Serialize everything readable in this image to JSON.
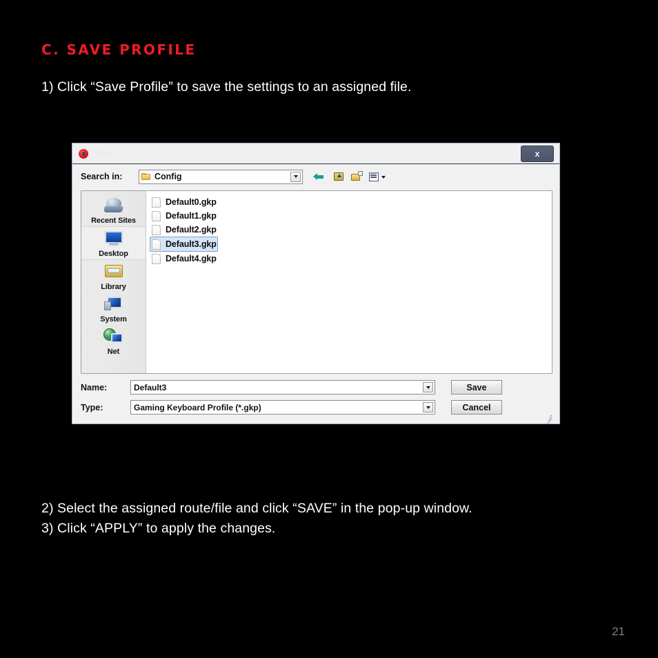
{
  "page": {
    "heading": "C. SAVE PROFILE",
    "heading_color": "#ED1C24",
    "instruction_1": "1) Click “Save Profile” to save the settings to an assigned file.",
    "instruction_2": "2) Select the assigned route/file and click “SAVE” in the pop-up window.",
    "instruction_3": "3) Click “APPLY” to apply the changes.",
    "page_number": "21",
    "background_color": "#000000",
    "text_color": "#FFFFFF"
  },
  "dialog": {
    "title": "Save",
    "close_label": "x",
    "lookin": {
      "label": "Search in:",
      "value": "Config",
      "icon": "folder-icon"
    },
    "toolbar": [
      {
        "name": "back-icon",
        "title": "Back"
      },
      {
        "name": "up-one-level-icon",
        "title": "Up One Level"
      },
      {
        "name": "new-folder-icon",
        "title": "Create New Folder"
      },
      {
        "name": "views-icon",
        "title": "Views"
      }
    ],
    "places": [
      {
        "label": "Recent Sites",
        "icon": "recent-sites-icon",
        "selected": false
      },
      {
        "label": "Desktop",
        "icon": "desktop-icon",
        "selected": true
      },
      {
        "label": "Library",
        "icon": "library-icon",
        "selected": false
      },
      {
        "label": "System",
        "icon": "system-icon",
        "selected": false
      },
      {
        "label": "Net",
        "icon": "net-icon",
        "selected": false
      }
    ],
    "files": [
      {
        "name": "Default0.gkp",
        "selected": false
      },
      {
        "name": "Default1.gkp",
        "selected": false
      },
      {
        "name": "Default2.gkp",
        "selected": false
      },
      {
        "name": "Default3.gkp",
        "selected": true
      },
      {
        "name": "Default4.gkp",
        "selected": false
      }
    ],
    "form": {
      "name_label": "Name:",
      "name_value": "Default3",
      "type_label": "Type:",
      "type_value": "Gaming  Keyboard Profile (*.gkp)",
      "save_button": "Save",
      "cancel_button": "Cancel"
    },
    "selection_color": "#D4E6F7"
  }
}
